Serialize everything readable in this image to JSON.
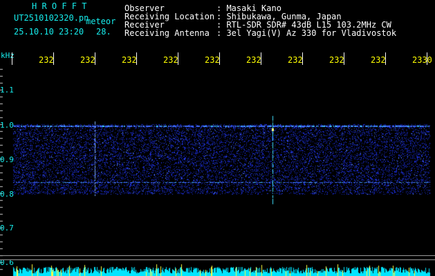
{
  "header": {
    "app_title": "H R O F F T",
    "filename": "UT2510102320.pn",
    "meteor_label": "meteor",
    "datetime": "25.10.10 23:20",
    "count": "28.",
    "fields": [
      {
        "label": "Observer",
        "value": ": Masaki Kano"
      },
      {
        "label": "Receiving Location",
        "value": ": Shibukawa, Gunma, Japan"
      },
      {
        "label": "Receiver",
        "value": ": RTL-SDR SDR# 43dB L15 103.2MHz CW"
      },
      {
        "label": "Receiving Antenna",
        "value": ": 3el Yagi(V) Az 330 for Vladivostok"
      }
    ]
  },
  "axis": {
    "unit": "kHz",
    "y_labels": [
      "1.1",
      "1.0",
      "0.9",
      "0.8",
      "0.7",
      "0.6"
    ],
    "x_labels": [
      "232",
      "232",
      "232",
      "232",
      "232",
      "232",
      "232",
      "232",
      "232",
      "2330"
    ]
  },
  "colors": {
    "header_cyan": "#16ecec",
    "tick_yellow": "#ffff00",
    "noise_blue": "#1a2bd0",
    "signal_cyan": "#40e0ff",
    "baseline_cyan": "#00e5ff",
    "baseline_yellow": "#ffff40"
  }
}
